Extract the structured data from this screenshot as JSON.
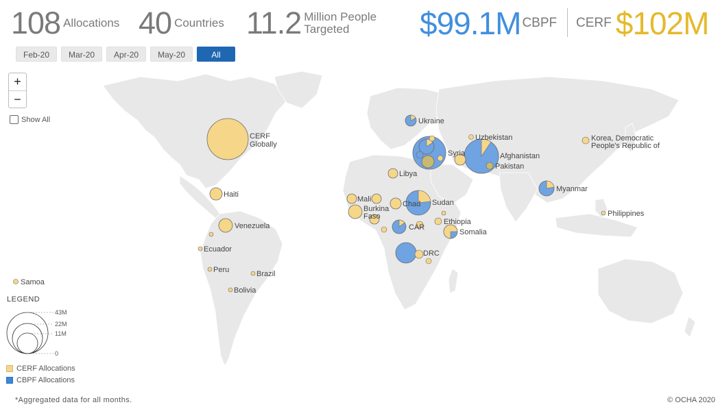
{
  "stats": {
    "allocations": {
      "value": "108",
      "label": "Allocations"
    },
    "countries": {
      "value": "40",
      "label": "Countries"
    },
    "people": {
      "value": "11.2",
      "label_line1": "Million People",
      "label_line2": "Targeted"
    },
    "cbpf": {
      "value": "$99.1M",
      "label": "CBPF"
    },
    "cerf": {
      "label": "CERF",
      "value": "$102M"
    }
  },
  "months": [
    {
      "label": "Feb-20",
      "active": false
    },
    {
      "label": "Mar-20",
      "active": false
    },
    {
      "label": "Apr-20",
      "active": false
    },
    {
      "label": "May-20",
      "active": false
    },
    {
      "label": "All",
      "active": true
    }
  ],
  "zoom": {
    "in": "+",
    "out": "−"
  },
  "show_all": {
    "label": "Show All",
    "checked": false
  },
  "colors": {
    "cerf": "#f6d689",
    "cbpf": "#6fa3e2",
    "land": "#e8e8e8"
  },
  "legend": {
    "title": "LEGEND",
    "sizes": [
      "43M",
      "22M",
      "11M",
      "0"
    ],
    "keys": [
      {
        "label": "CERF Allocations",
        "color": "#f6d689"
      },
      {
        "label": "CBPF Allocations",
        "color": "#6fa3e2"
      }
    ]
  },
  "footnote": "*Aggregated data for all months.",
  "copyright": "© OCHA 2020",
  "map_labels": {
    "cerf_globally_1": "CERF",
    "cerf_globally_2": "Globally",
    "ukraine": "Ukraine",
    "uzbekistan": "Uzbekistan",
    "korea_1": "Korea, Democratic",
    "korea_2": "People's Republic of",
    "syria": "Syria",
    "afghanistan": "Afghanistan",
    "pakistan": "Pakistan",
    "libya": "Libya",
    "myanmar": "Myanmar",
    "haiti": "Haiti",
    "mali": "Mali",
    "burkina_1": "Burkina",
    "burkina_2": "Faso",
    "chad": "Chad",
    "sudan": "Sudan",
    "philippines": "Philippines",
    "venezuela": "Venezuela",
    "car": "CAR",
    "ethiopia": "Ethiopia",
    "somalia": "Somalia",
    "ecuador": "Ecuador",
    "drc": "DRC",
    "peru": "Peru",
    "brazil": "Brazil",
    "samoa": "Samoa",
    "bolivia": "Bolivia"
  }
}
